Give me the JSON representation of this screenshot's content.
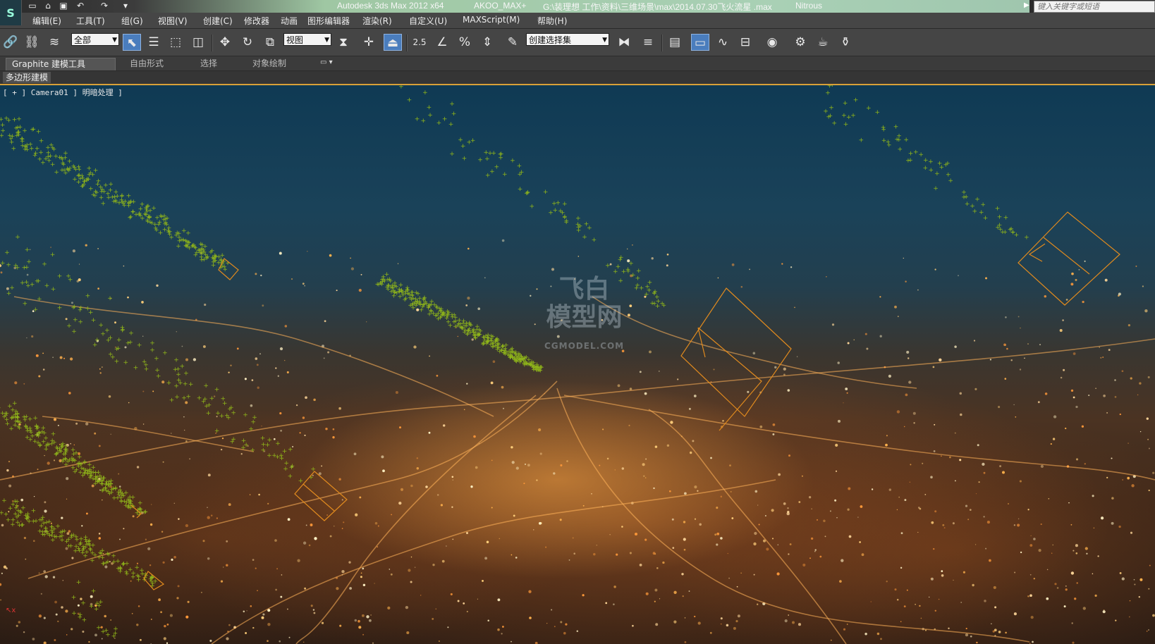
{
  "app": {
    "logo": "S",
    "title_parts": [
      "Autodesk 3ds Max  2012 x64",
      "AKOO_MAX+",
      "G:\\装理想 工作\\资料\\三维场景\\max\\2014.07.30飞火流星 .max",
      "Nitrous"
    ],
    "search_placeholder": "键入关键字或短语"
  },
  "quick_access": [
    "new-icon",
    "open-icon",
    "save-icon",
    "undo-icon",
    "redo-icon",
    "dropdown-icon"
  ],
  "menu": [
    "编辑(E)",
    "工具(T)",
    "组(G)",
    "视图(V)",
    "创建(C)",
    "修改器",
    "动画",
    "图形编辑器",
    "渲染(R)",
    "自定义(U)",
    "MAXScript(M)",
    "帮助(H)"
  ],
  "toolbar": {
    "selection_filter": "全部",
    "reference_coord": "视图",
    "named_selection": "创建选择集",
    "snap_label": "2.5"
  },
  "ribbon": {
    "tabs": [
      "Graphite 建模工具",
      "自由形式",
      "选择",
      "对象绘制"
    ],
    "active_tab": 0,
    "panel_label": "多边形建模"
  },
  "viewport": {
    "label": "[ + ] Camera01 ] 明暗处理 ]",
    "watermark_cn": "飞白\n模型网",
    "watermark_text": "CGMODEL.COM",
    "accent_color": "#d8a038",
    "particle_color": "#8fb51a",
    "gizmo_color": "#e08a1e"
  }
}
